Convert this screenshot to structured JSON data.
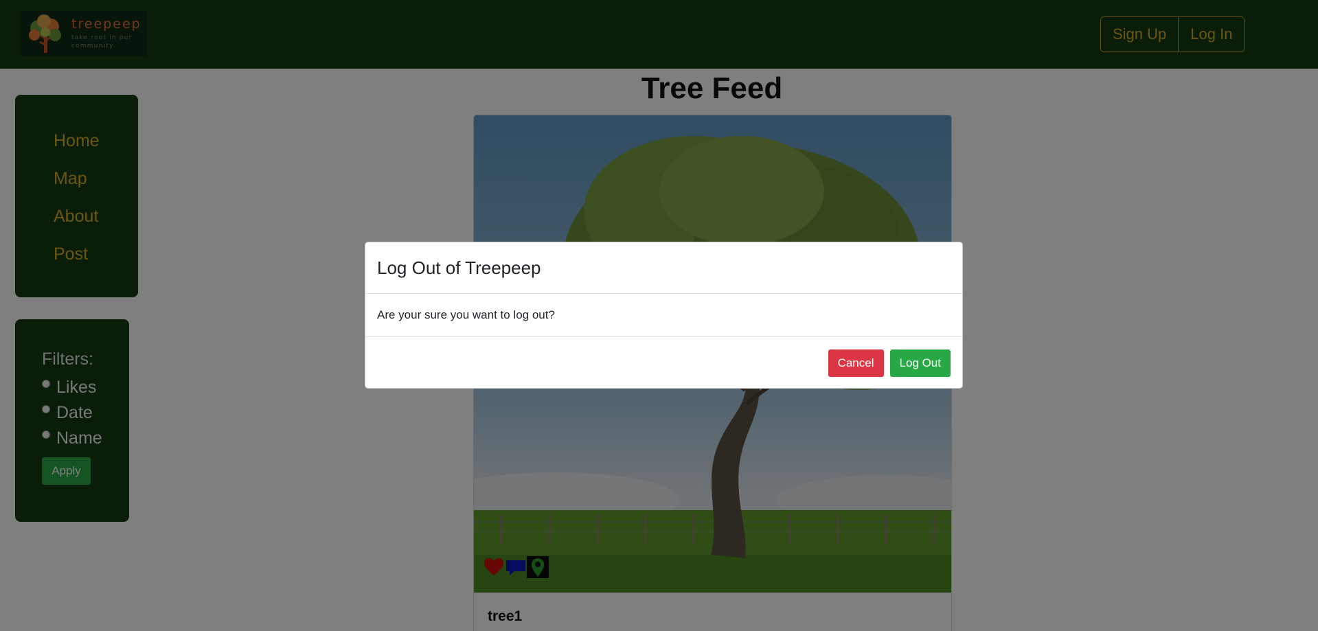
{
  "brand": {
    "name": "treepeep",
    "tagline": "take root in our community"
  },
  "header": {
    "signup_label": "Sign Up",
    "login_label": "Log In"
  },
  "sidebar": {
    "items": [
      {
        "label": "Home"
      },
      {
        "label": "Map"
      },
      {
        "label": "About"
      },
      {
        "label": "Post"
      }
    ]
  },
  "filters": {
    "title": "Filters:",
    "options": [
      {
        "label": "Likes"
      },
      {
        "label": "Date"
      },
      {
        "label": "Name"
      }
    ],
    "apply_label": "Apply"
  },
  "feed": {
    "title": "Tree Feed",
    "posts": [
      {
        "name": "tree1",
        "icons": [
          "heart-icon",
          "comment-icon",
          "location-pin-icon"
        ]
      }
    ]
  },
  "modal": {
    "title": "Log Out of Treepeep",
    "message": "Are your sure you want to log out?",
    "cancel_label": "Cancel",
    "confirm_label": "Log Out"
  },
  "colors": {
    "nav_bg": "#133a11",
    "accent_gold": "#d8ad21",
    "success": "#28a745",
    "danger": "#dc3545"
  }
}
